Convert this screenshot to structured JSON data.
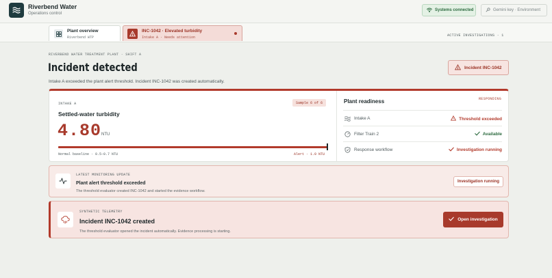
{
  "header": {
    "app_title": "Riverbend Water",
    "app_subtitle": "Operations control",
    "systems_status": "Systems connected",
    "gemini_key": "Gemini key · Environment"
  },
  "tabs": [
    {
      "title": "Plant overview",
      "subtitle": "Riverbend WTP"
    },
    {
      "title": "INC-1042 · Elevated turbidity",
      "subtitle": "Intake A · Needs attention"
    }
  ],
  "active_investigations": "ACTIVE INVESTIGATIONS · 1",
  "page": {
    "breadcrumb": "RIVERBEND WATER TREATMENT PLANT · SHIFT A",
    "title": "Incident detected",
    "subtitle": "Intake A exceeded the plant alert threshold. Incident INC-1042 was created automatically.",
    "incident_badge": "Incident INC-1042"
  },
  "reading": {
    "intake_label": "INTAKE A",
    "sample": "Sample 6 of 6",
    "metric": "Settled-water turbidity",
    "value": "4.80",
    "unit": "NTU",
    "baseline": "Normal baseline · 0.5–0.7 NTU",
    "alert": "Alert · 1.0 NTU",
    "bar_fill_fraction": 1.0
  },
  "readiness": {
    "title": "Plant readiness",
    "status": "RESPONDING",
    "rows": [
      {
        "name": "Intake A",
        "status": "Threshold exceeded",
        "icon": "waves-icon",
        "status_icon": "warning-icon",
        "color": "#b23a2b"
      },
      {
        "name": "Filter Train 2",
        "status": "Available",
        "icon": "gauge-icon",
        "status_icon": "check-icon",
        "color": "#2c6a3f"
      },
      {
        "name": "Response workflow",
        "status": "Investigation running",
        "icon": "shield-icon",
        "status_icon": "check-icon",
        "color": "#b23a2b"
      }
    ]
  },
  "update": {
    "label": "LATEST MONITORING UPDATE",
    "title": "Plant alert threshold exceeded",
    "description": "The threshold evaluator created INC-1042 and started the evidence workflow.",
    "button": "Investigation running"
  },
  "created": {
    "label": "SYNTHETIC TELEMETRY",
    "title": "Incident INC-1042 created",
    "description": "The threshold evaluator opened the incident automatically. Evidence processing is starting.",
    "button": "Open investigation"
  },
  "colors": {
    "accent": "#b23a2b",
    "success": "#2c6a3f",
    "brand": "#1f3b3f"
  }
}
